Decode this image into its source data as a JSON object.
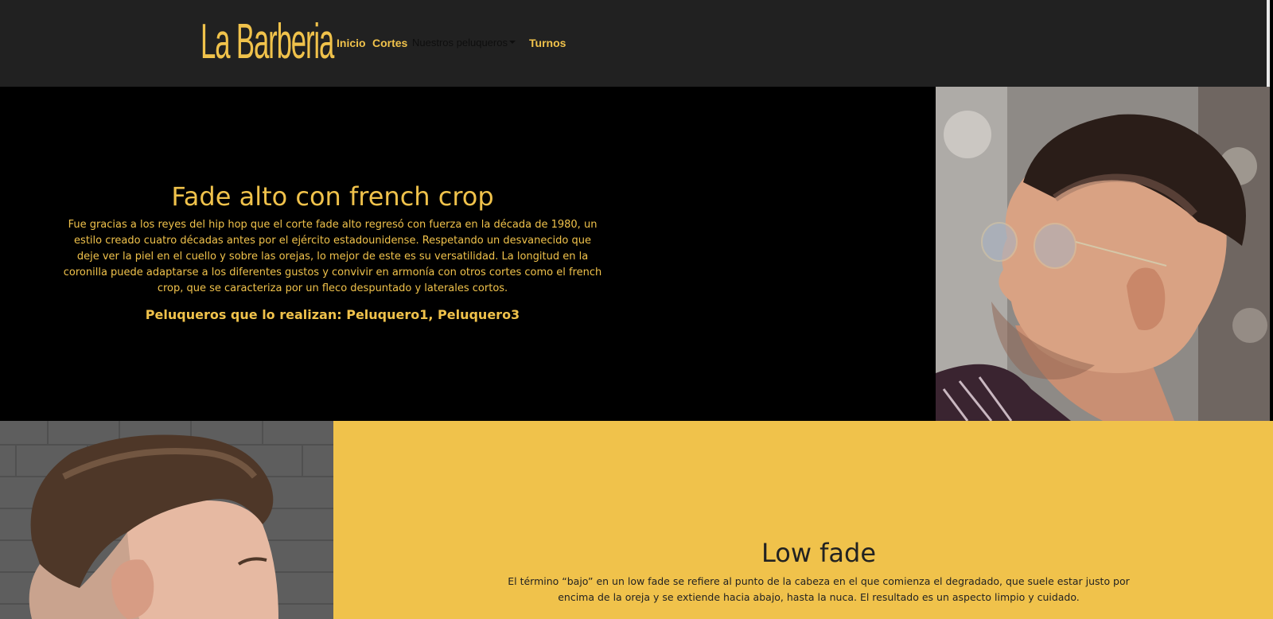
{
  "navbar": {
    "brand": "La Barberia",
    "items": [
      {
        "label": "Inicio"
      },
      {
        "label": "Cortes"
      },
      {
        "label": "Nuestros peluqueros"
      },
      {
        "label": "Turnos"
      }
    ]
  },
  "cuts": [
    {
      "title": "Fade alto con french crop",
      "description": "Fue gracias a los reyes del hip hop que el corte fade alto regresó con fuerza en la década de 1980, un estilo creado cuatro décadas antes por el ejército estadounidense. Respetando un desvanecido que deje ver la piel en el cuello y sobre las orejas, lo mejor de este es su versatilidad. La longitud en la coronilla puede adaptarse a los diferentes gustos y convivir en armonía con otros cortes como el french crop, que se caracteriza por un fleco despuntado y laterales cortos.",
      "barbers": "Peluqueros que lo realizan: Peluquero1, Peluquero3"
    },
    {
      "title": "Low fade",
      "description": "El término “bajo” en un low fade se refiere al punto de la cabeza en el que comienza el degradado, que suele estar justo por encima de la oreja y se extiende hacia abajo, hasta la nuca. El resultado es un aspecto limpio y cuidado."
    }
  ],
  "colors": {
    "accent": "#f0c24b",
    "navbar_bg": "#212121",
    "section_dark_bg": "#000000",
    "dark_text": "#222222"
  }
}
